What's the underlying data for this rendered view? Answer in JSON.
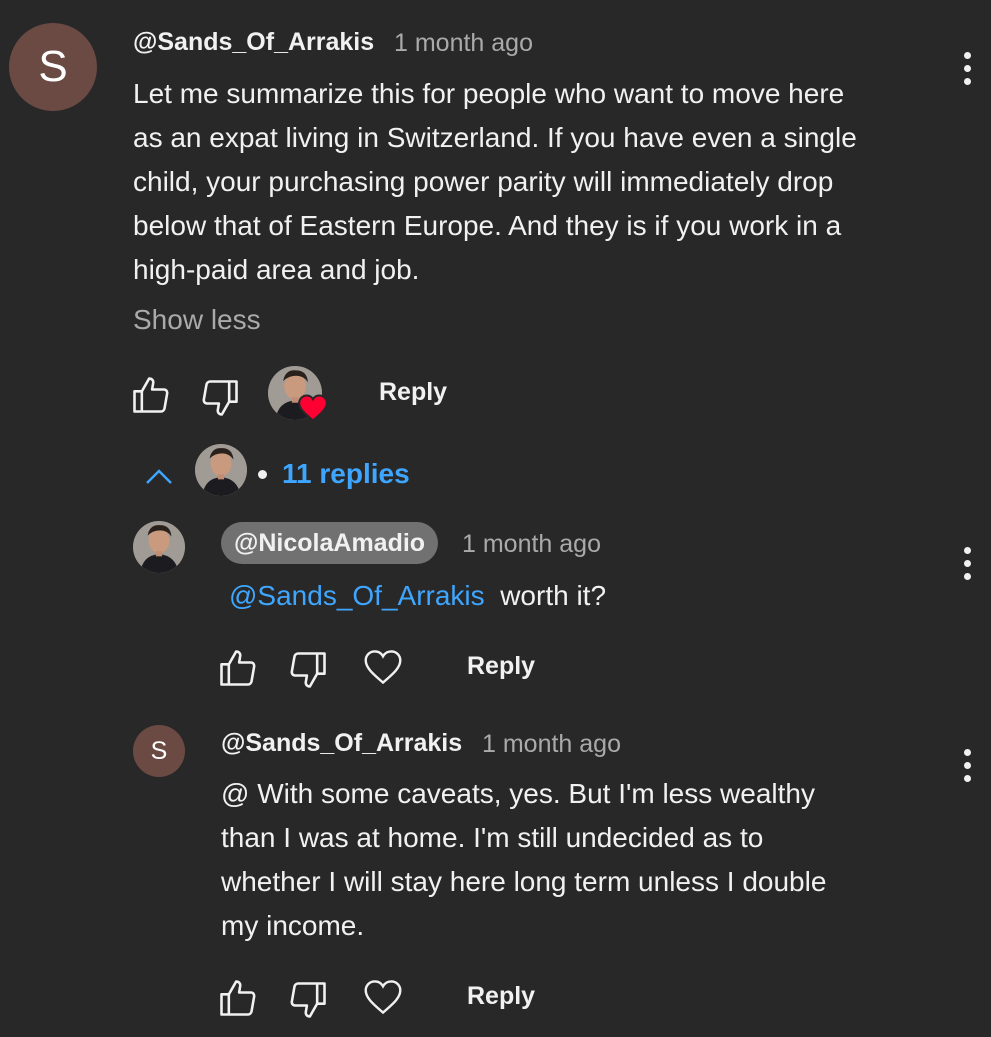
{
  "comment": {
    "avatar_letter": "S",
    "author": "@Sands_Of_Arrakis",
    "time": "1 month ago",
    "text_lines": [
      "Let me summarize this for people who want to move here",
      "as an expat living in Switzerland. If you have even a single",
      "child, your purchasing power parity will immediately drop",
      "below that of Eastern Europe. And they is if you work in a",
      "high-paid area and job."
    ],
    "show_less": "Show less",
    "reply_label": "Reply",
    "replies_count": "11 replies"
  },
  "replies": [
    {
      "author": "@NicolaAmadio",
      "time": "1 month ago",
      "mention": "@Sands_Of_Arrakis",
      "text": "worth it?",
      "reply_label": "Reply"
    },
    {
      "avatar_letter": "S",
      "author": "@Sands_Of_Arrakis",
      "time": "1 month ago",
      "text_lines": [
        "@ With some caveats, yes. But I'm less wealthy",
        "than I was at home. I'm still undecided as to",
        "whether I will stay here long term unless I double",
        "my income."
      ],
      "reply_label": "Reply"
    }
  ],
  "colors": {
    "background": "#282828",
    "link": "#3ea6ff",
    "heart": "#ff0033",
    "avatar_brown": "#6b4a44",
    "secondary_text": "#aaaaaa"
  }
}
